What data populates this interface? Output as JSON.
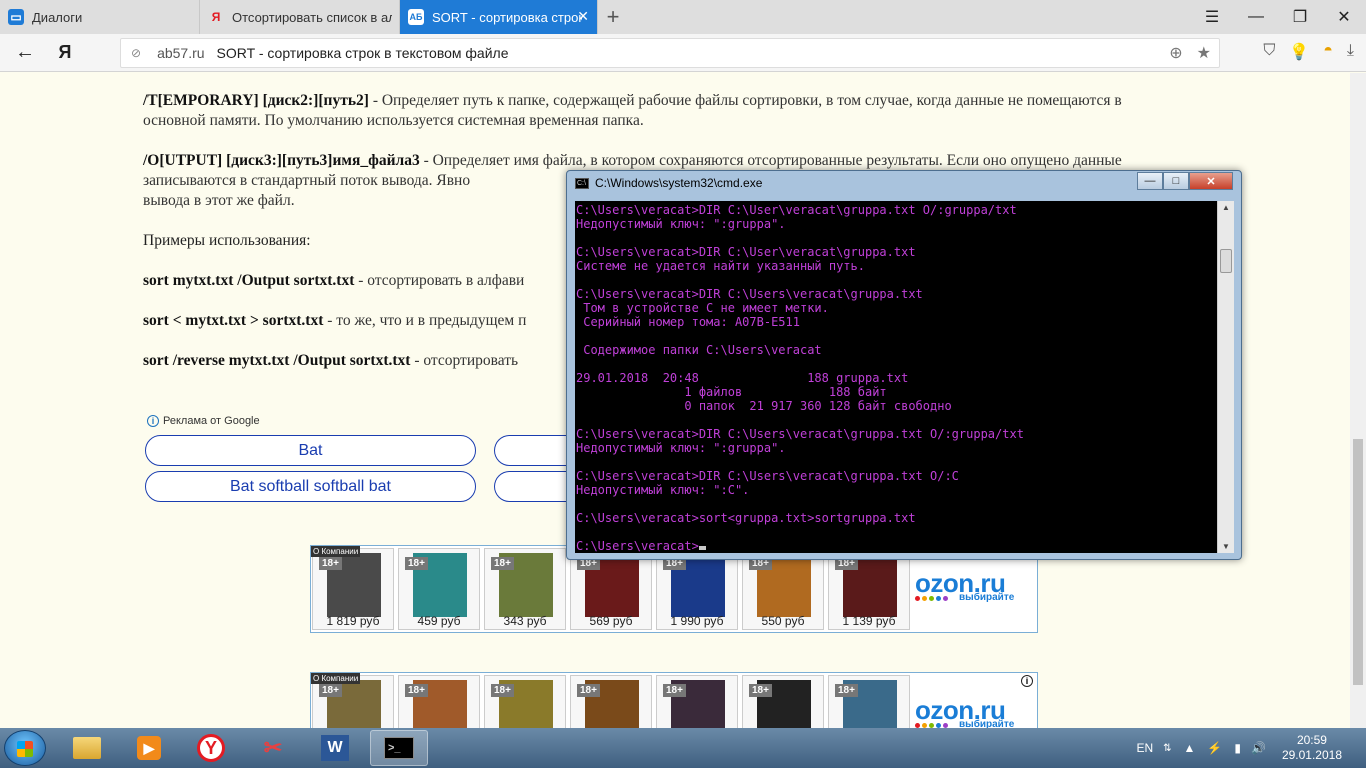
{
  "browser": {
    "tabs": [
      {
        "label": "Диалоги",
        "icon": "chat-icon",
        "color": "#1f7bd6"
      },
      {
        "label": "Отсортировать список в ал",
        "icon": "yandex-icon",
        "color": "#e31b23"
      },
      {
        "label": "SORT - сортировка строк",
        "icon": "site-favicon",
        "active": true
      }
    ],
    "new_tab": "+",
    "window_controls": {
      "menu": "☰",
      "minimize": "—",
      "restore": "❐",
      "close": "✕"
    },
    "address": {
      "back": "←",
      "yandex": "Я",
      "domain": "ab57.ru",
      "title": "SORT - сортировка строк в текстовом файле"
    }
  },
  "article": {
    "paragraphs": [
      {
        "bold": "/T[EMPORARY] [диск2:][путь2]",
        "text": " - Определяет путь к папке, содержащей рабочие файлы сортировки, в том случае, когда данные не помещаются в основной памяти. По умолчанию используется системная временная папка."
      },
      {
        "bold": "/O[UTPUT] [диск3:][путь3]имя_файла3",
        "text": " - Определяет имя файла, в котором сохраняются отсортированные результаты. Если оно опущено данные записываются в стандартный поток вывода. Явно"
      },
      {
        "bold": "",
        "text": "вывода в этот же файл."
      },
      {
        "bold": "",
        "text": "Примеры использования:"
      },
      {
        "bold": "sort mytxt.txt /Output sortxt.txt",
        "text": " - отсортировать в алфави"
      },
      {
        "bold": "sort < mytxt.txt > sortxt.txt",
        "text": " - то же, что и в предыдущем п"
      },
      {
        "bold": "sort /reverse mytxt.txt /Output sortxt.txt",
        "text": " - отсортировать"
      }
    ]
  },
  "ads": {
    "label": "Реклама от Google",
    "buttons": [
      "Bat",
      "Bat softball softball bat"
    ]
  },
  "ozon": {
    "tag": "О Компании",
    "logo": "ozon.ru",
    "slogan": "выбирайте",
    "row1": [
      {
        "age": "18+",
        "price": "1 819 руб"
      },
      {
        "age": "18+",
        "price": "459 руб"
      },
      {
        "age": "18+",
        "price": "343 руб"
      },
      {
        "age": "18+",
        "price": "569 руб"
      },
      {
        "age": "18+",
        "price": "1 990 руб"
      },
      {
        "age": "18+",
        "price": "550 руб"
      },
      {
        "age": "18+",
        "price": "1 139 руб"
      }
    ],
    "row2": [
      {
        "age": "18+"
      },
      {
        "age": "18+"
      },
      {
        "age": "18+"
      },
      {
        "age": "18+"
      },
      {
        "age": "18+"
      },
      {
        "age": "18+"
      },
      {
        "age": "18+"
      }
    ]
  },
  "cmd": {
    "title": "C:\\Windows\\system32\\cmd.exe",
    "buttons": {
      "minimize": "—",
      "maximize": "□",
      "close": "✕"
    },
    "lines": [
      "C:\\Users\\veracat>DIR C:\\User\\veracat\\gruppa.txt O/:gruppa/txt",
      "Недопустимый ключ: \":gruppa\".",
      "",
      "C:\\Users\\veracat>DIR C:\\User\\veracat\\gruppa.txt",
      "Системе не удается найти указанный путь.",
      "",
      "C:\\Users\\veracat>DIR C:\\Users\\veracat\\gruppa.txt",
      " Том в устройстве C не имеет метки.",
      " Серийный номер тома: A07B-E511",
      "",
      " Содержимое папки C:\\Users\\veracat",
      "",
      "29.01.2018  20:48               188 gruppa.txt",
      "               1 файлов            188 байт",
      "               0 папок  21 917 360 128 байт свободно",
      "",
      "C:\\Users\\veracat>DIR C:\\Users\\veracat\\gruppa.txt O/:gruppa/txt",
      "Недопустимый ключ: \":gruppa\".",
      "",
      "C:\\Users\\veracat>DIR C:\\Users\\veracat\\gruppa.txt O/:C",
      "Недопустимый ключ: \":C\".",
      "",
      "C:\\Users\\veracat>sort<gruppa.txt>sortgruppa.txt",
      "",
      "C:\\Users\\veracat>"
    ],
    "text_color": "#c040d8"
  },
  "taskbar": {
    "apps": [
      {
        "name": "explorer",
        "icon": "folder-icon"
      },
      {
        "name": "media",
        "icon": "media-player-icon"
      },
      {
        "name": "yandex",
        "icon": "yandex-browser-icon",
        "glyph": "Y"
      },
      {
        "name": "snipping",
        "icon": "snipping-tool-icon"
      },
      {
        "name": "word",
        "icon": "word-icon",
        "glyph": "W"
      },
      {
        "name": "cmd",
        "icon": "cmd-icon",
        "glyph": ">_",
        "active": true
      }
    ],
    "lang": "EN",
    "time": "20:59",
    "date": "29.01.2018"
  }
}
